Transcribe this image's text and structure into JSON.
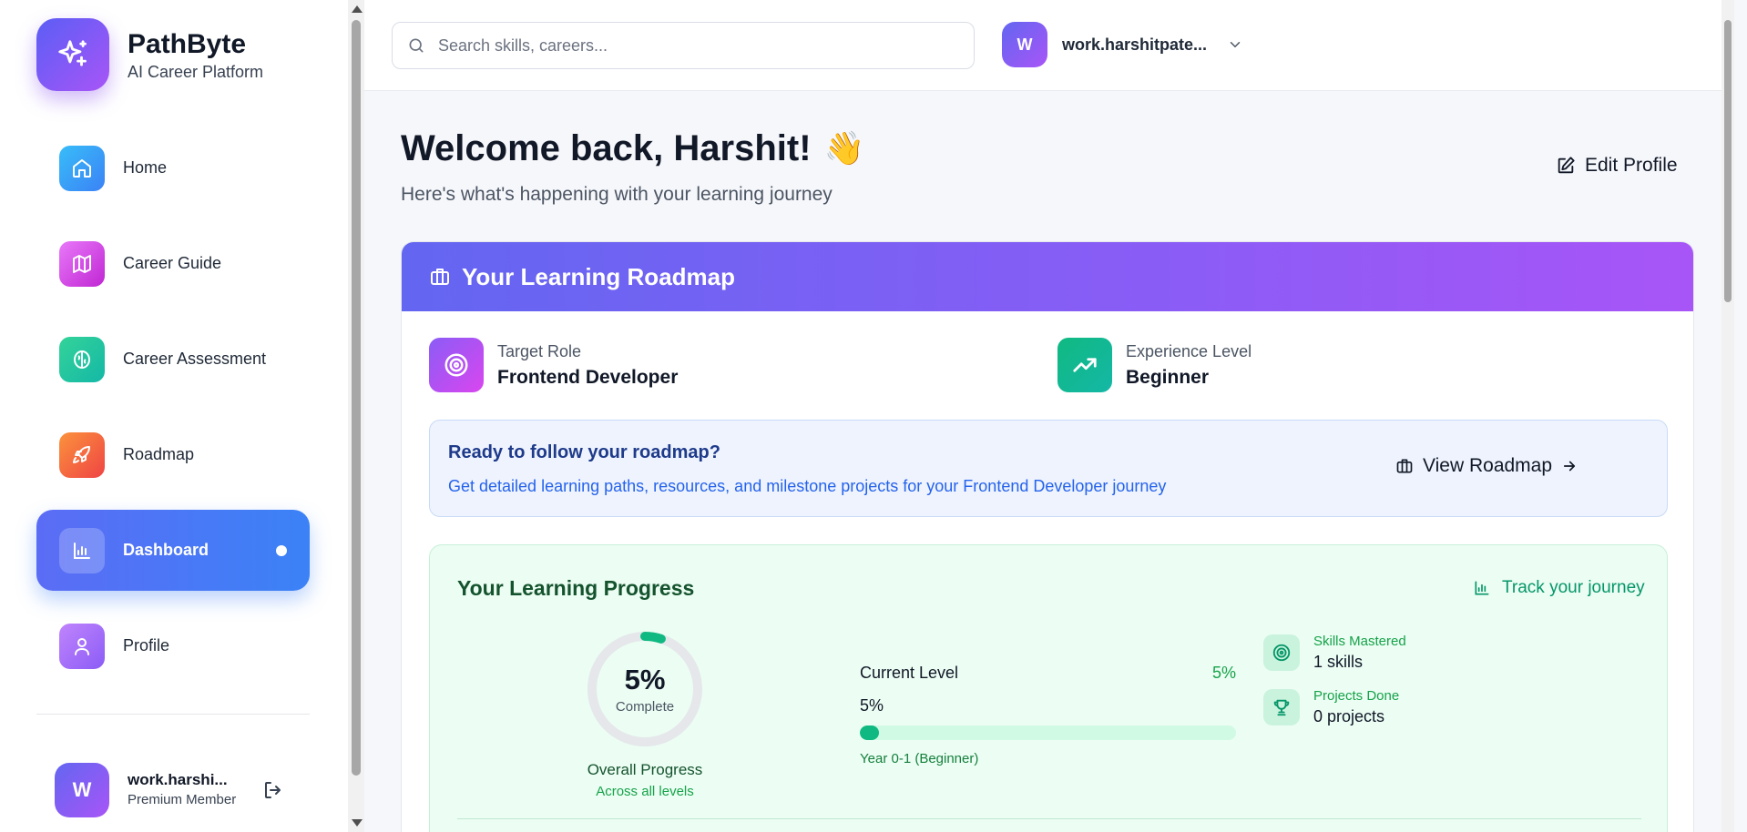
{
  "brand": {
    "name": "PathByte",
    "subtitle": "AI Career Platform"
  },
  "sidebar": {
    "items": [
      {
        "label": "Home",
        "icon": "home-icon",
        "color": "#3b82f6"
      },
      {
        "label": "Career Guide",
        "icon": "map-icon",
        "color": "#d946ef"
      },
      {
        "label": "Career Assessment",
        "icon": "brain-icon",
        "color": "#10b981"
      },
      {
        "label": "Roadmap",
        "icon": "rocket-icon",
        "color": "#f97316"
      },
      {
        "label": "Dashboard",
        "icon": "bar-chart-icon",
        "active": true
      },
      {
        "label": "Profile",
        "icon": "user-icon",
        "color": "#a855f7"
      }
    ],
    "user": {
      "initial": "W",
      "name": "work.harshi...",
      "role": "Premium Member"
    }
  },
  "topbar": {
    "search_placeholder": "Search skills, careers...",
    "account_initial": "W",
    "account_name": "work.harshitpate..."
  },
  "welcome": {
    "title": "Welcome back, Harshit!",
    "emoji": "👋",
    "subtitle": "Here's what's happening with your learning journey",
    "edit_profile": "Edit Profile"
  },
  "roadmap": {
    "header": "Your Learning Roadmap",
    "target_role_label": "Target Role",
    "target_role": "Frontend Developer",
    "experience_label": "Experience Level",
    "experience": "Beginner",
    "cta_title": "Ready to follow your roadmap?",
    "cta_desc": "Get detailed learning paths, resources, and milestone projects for your Frontend Developer journey",
    "cta_button": "View Roadmap"
  },
  "progress": {
    "title": "Your Learning Progress",
    "track_label": "Track your journey",
    "overall_value": 0.05,
    "overall_pct": "5%",
    "overall_complete": "Complete",
    "overall_label": "Overall Progress",
    "overall_sub": "Across all levels",
    "current_level_label": "Current Level",
    "current_level_pct": "5%",
    "current_level_value": 0.05,
    "level_year": "Year 0-1 (Beginner)",
    "skills_label": "Skills Mastered",
    "skills_value": "1 skills",
    "projects_label": "Projects Done",
    "projects_value": "0 projects"
  },
  "colors": {
    "accent": "#6366f1",
    "accent2": "#a855f7",
    "success": "#10b981",
    "active_nav": "#3b82f6"
  }
}
